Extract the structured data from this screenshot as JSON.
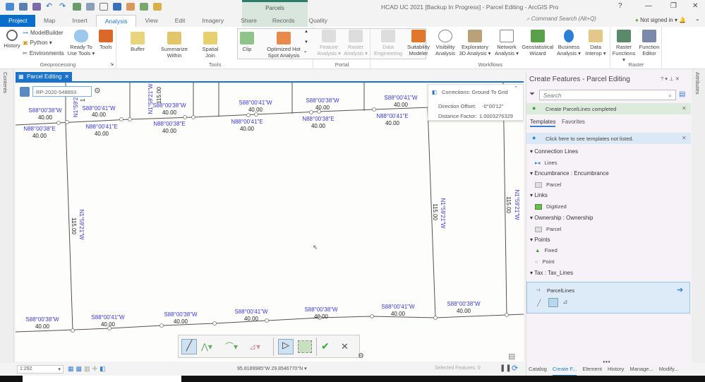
{
  "window": {
    "title": "HCAD UC 2021 [Backup In Progress] - Parcel Editing - ArcGIS Pro",
    "help": "?",
    "minimize": "—",
    "restore": "❐",
    "close": "✕"
  },
  "contextual": {
    "label": "Parcels"
  },
  "tabs": [
    "Project",
    "Map",
    "Insert",
    "Analysis",
    "View",
    "Edit",
    "Imagery",
    "Share",
    "Records",
    "Quality"
  ],
  "command_search": {
    "placeholder": "Command Search (Alt+Q)"
  },
  "user": {
    "signin": "Not signed in ▾"
  },
  "ribbon": {
    "geoprocessing": {
      "label": "Geoprocessing",
      "history": "History",
      "modelbuilder": "ModelBuilder",
      "python": "Python ▾",
      "environments": "Environments",
      "ready": "Ready To Use Tools ▾",
      "tools": "Tools"
    },
    "tools": {
      "label": "Tools",
      "items": [
        "Buffer",
        "Summarize Within",
        "Spatial Join",
        "Clip",
        "Optimized Hot Spot Analysis"
      ]
    },
    "portal": {
      "label": "Portal",
      "items": [
        "Feature Analysis ▾",
        "Raster Analysis ▾"
      ]
    },
    "workflows": {
      "label": "Workflows",
      "items": [
        "Data Engineering",
        "Suitability Modeler",
        "Visibility Analysis",
        "Exploratory 3D Analysis ▾",
        "Network Analysis ▾",
        "Geostatistical Wizard",
        "Business Analysis ▾",
        "Data Interop ▾"
      ]
    },
    "raster": {
      "label": "Raster",
      "items": [
        "Raster Functions ▾",
        "Function Editor"
      ]
    }
  },
  "side": {
    "contents": "Contents",
    "attributes": "Attributes"
  },
  "map_tab": {
    "label": "Parcel Editing",
    "close": "✕"
  },
  "record": {
    "value": "RP-2020-548893"
  },
  "corrections": {
    "title": "Corrections: Ground To Grid",
    "direction_label": "Direction Offset:",
    "direction": "-0°00'12\"",
    "distance_label": "Distance Factor:",
    "distance": "1.0003276329"
  },
  "map": {
    "labels": {
      "t1": [
        "S88°00'38\"W",
        "40.00"
      ],
      "t2": [
        "S88°00'41\"W",
        "40.00"
      ],
      "t3": [
        "S88°00'38\"W",
        "40.00"
      ],
      "t4": [
        "S88°00'41\"W",
        "40.00"
      ],
      "t5": [
        "S88°00'38\"W",
        "40.00"
      ],
      "t6": [
        "S88°00'41\"W",
        "40.00"
      ],
      "n1": [
        "N88°00'38\"E",
        "40.00"
      ],
      "n2": [
        "N88°00'41\"E",
        "40.00"
      ],
      "n3": [
        "N88°00'38\"E",
        "40.00"
      ],
      "n4": [
        "N88°00'41\"E",
        "40.00"
      ],
      "n5": [
        "N88°00'38\"E",
        "40.00"
      ],
      "n6": [
        "N88°00'41\"E",
        "40.00"
      ],
      "b1": [
        "S88°00'38\"W",
        "40.00"
      ],
      "b2": [
        "S88°00'41\"W",
        "40.00"
      ],
      "b3": [
        "S88°00'38\"W",
        "40.00"
      ],
      "b4": [
        "S88°00'41\"W",
        "40.00"
      ],
      "b5": [
        "S88°00'38\"W",
        "40.00"
      ],
      "b6": [
        "S88°00'41\"W",
        "40.00"
      ],
      "b7": [
        "S88°00'38\"W",
        "40.00"
      ],
      "v1": [
        "N1°59'21\"W",
        "115.00"
      ],
      "v2": [
        "N1°59'21\"W",
        "115.00"
      ],
      "v3": [
        "N1°59'21\"W",
        "115.00"
      ],
      "v4": [
        "N1°59'21\"W",
        "115.00"
      ],
      "v5": [
        "N1°59'2",
        "1"
      ]
    }
  },
  "status": {
    "scale": "1:292",
    "coords": "95.8189985°W 29.8546770°N ▾",
    "selected": "Selected Features: 0"
  },
  "panel": {
    "title": "Create Features - Parcel Editing",
    "controls": "? ▾ ⊥ ✕",
    "search_placeholder": "Search",
    "success": "Create ParcelLines completed",
    "tabs": [
      "Templates",
      "Favorites"
    ],
    "info": "Click here to see templates not listed.",
    "groups": [
      {
        "name": "Connection Lines",
        "items": [
          "Lines"
        ]
      },
      {
        "name": "Encumbrance : Encumbrance",
        "items": [
          "Parcel"
        ]
      },
      {
        "name": "Links",
        "items": [
          "Digitized"
        ]
      },
      {
        "name": "Ownership : Ownership",
        "items": [
          "Parcel"
        ]
      },
      {
        "name": "Points",
        "items": [
          "Fixed",
          "Point"
        ]
      },
      {
        "name": "Tax : Tax_Lines",
        "items": []
      }
    ],
    "selected_template": "ParcelLines",
    "bottom_tabs": [
      "Catalog",
      "Create F...",
      "Element",
      "History",
      "Manage...",
      "Modify..."
    ]
  },
  "colors": {
    "accent": "#1a73c9",
    "label_blue": "#3b3bd6",
    "success_bg": "#dcebdc",
    "info_bg": "#dbe9f7"
  }
}
